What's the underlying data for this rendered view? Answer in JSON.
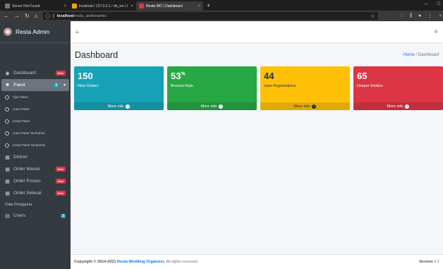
{
  "browser": {
    "tabs": [
      {
        "label": "Server Not Found",
        "color": "#777777"
      },
      {
        "label": "localhost / 127.0.0.1 / db_wo / t",
        "color": "#f0a30a"
      },
      {
        "label": "Resta WO | Dashboard",
        "color": "#dc3545"
      }
    ],
    "url_host": "localhost",
    "url_path": "/resta_wo/beranda"
  },
  "brand": {
    "title": "Resta Admin"
  },
  "sidebar": {
    "items": [
      {
        "label": "Dashboard",
        "icon": "dashboard-icon",
        "badge": "New"
      },
      {
        "label": "Paket",
        "icon": "box-icon",
        "badge": "3"
      },
      {
        "label": "Tipe Paket"
      },
      {
        "label": "Judul Paket"
      },
      {
        "label": "Detail Paket"
      },
      {
        "label": "Judul Paket Tambahan"
      },
      {
        "label": "Detail Paket Tambahan"
      },
      {
        "label": "Diskon",
        "icon": "table-icon"
      },
      {
        "label": "Order Masuk",
        "icon": "table-icon",
        "badge": "New"
      },
      {
        "label": "Order Proses",
        "icon": "table-icon",
        "badge": "New"
      },
      {
        "label": "Order Selesai",
        "icon": "table-icon",
        "badge": "New"
      }
    ],
    "section": "Data Pengguna",
    "users": {
      "label": "Users",
      "badge": "2"
    }
  },
  "topnav": {
    "menu_icon": "≡"
  },
  "page": {
    "title": "Dashboard",
    "crumb_home": "Home",
    "crumb_sep": "/",
    "crumb_current": "Dashboard"
  },
  "boxes": [
    {
      "value": "150",
      "suffix": "",
      "label": "New Orders",
      "more": "More info",
      "color": "#17a2b8"
    },
    {
      "value": "53",
      "suffix": "%",
      "label": "Bounce Rate",
      "more": "More info",
      "color": "#28a745"
    },
    {
      "value": "44",
      "suffix": "",
      "label": "User Registrations",
      "more": "More info",
      "color": "#ffc107"
    },
    {
      "value": "65",
      "suffix": "",
      "label": "Unique Visitors",
      "more": "More info",
      "color": "#dc3545"
    }
  ],
  "footer": {
    "copyright": "Copyright © 2014-2021",
    "brand": "Resta Wedding Organizer.",
    "rights": "All rights reserved.",
    "version_label": "Version",
    "version": "3.2"
  }
}
